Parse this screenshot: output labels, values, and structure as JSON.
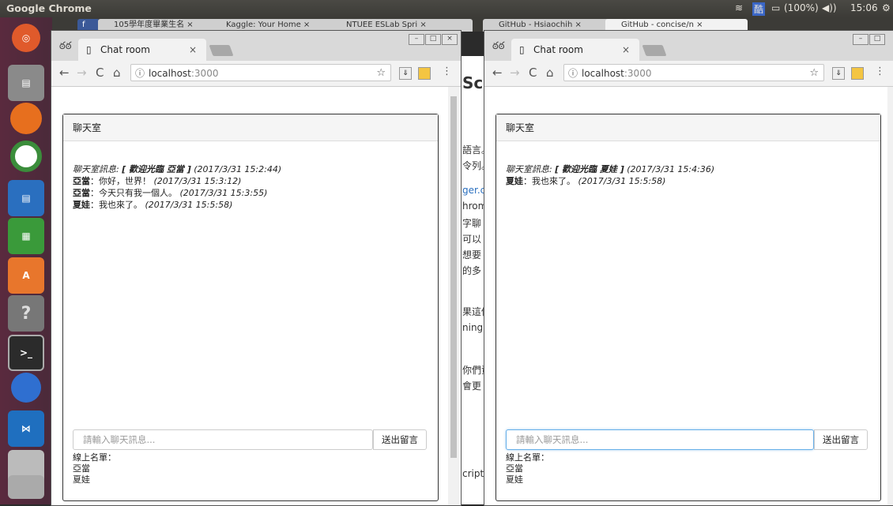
{
  "topbar": {
    "app_name": "Google Chrome",
    "battery": "(100%)",
    "clock": "15:06"
  },
  "launcher": {
    "items": [
      "ubuntu-icon",
      "files-icon",
      "firefox-icon",
      "chrome-icon",
      "writer-icon",
      "calc-icon",
      "software-center-icon",
      "help-icon",
      "terminal-icon",
      "drop-icon",
      "vscode-icon",
      "disk-icon"
    ]
  },
  "bg_tabs": [
    "105學年度畢業生名",
    "Kaggle: Your Home",
    "NTUEE ESLab Spri",
    "GitHub - Hsiaochih",
    "GitHub - concise/n"
  ],
  "bg_page_snippets": [
    "Sc",
    "語言。",
    "令列。",
    "ger.c",
    "hrom",
    "字聊",
    "可以",
    "想要",
    "的多",
    "果這個",
    "ning y",
    "你們資",
    "會更",
    "cript-s"
  ],
  "left_window": {
    "tab_title": "Chat room",
    "url_host": "localhost",
    "url_port": ":3000",
    "panel_title": "聊天室",
    "messages": [
      {
        "prefix": "聊天室訊息: ",
        "emph": "[ 歡迎光臨 亞當 ]",
        "time": " (2017/3/31 15:2:44)"
      },
      {
        "name": "亞當",
        "text": "：你好，世界！",
        "time": " (2017/3/31 15:3:12)"
      },
      {
        "name": "亞當",
        "text": "：今天只有我一個人。",
        "time": " (2017/3/31 15:3:55)"
      },
      {
        "name": "夏娃",
        "text": "：我也來了。",
        "time": " (2017/3/31 15:5:58)"
      }
    ],
    "input_placeholder": "請輸入聊天訊息...",
    "send_label": "送出留言",
    "online_label": "線上名單：",
    "online_users": [
      "亞當",
      "夏娃"
    ]
  },
  "right_window": {
    "tab_title": "Chat room",
    "url_host": "localhost",
    "url_port": ":3000",
    "panel_title": "聊天室",
    "messages": [
      {
        "prefix": "聊天室訊息: ",
        "emph": "[ 歡迎光臨 夏娃 ]",
        "time": " (2017/3/31 15:4:36)"
      },
      {
        "name": "夏娃",
        "text": "：我也來了。",
        "time": " (2017/3/31 15:5:58)"
      }
    ],
    "input_placeholder": "請輸入聊天訊息...",
    "send_label": "送出留言",
    "online_label": "線上名單：",
    "online_users": [
      "亞當",
      "夏娃"
    ]
  }
}
